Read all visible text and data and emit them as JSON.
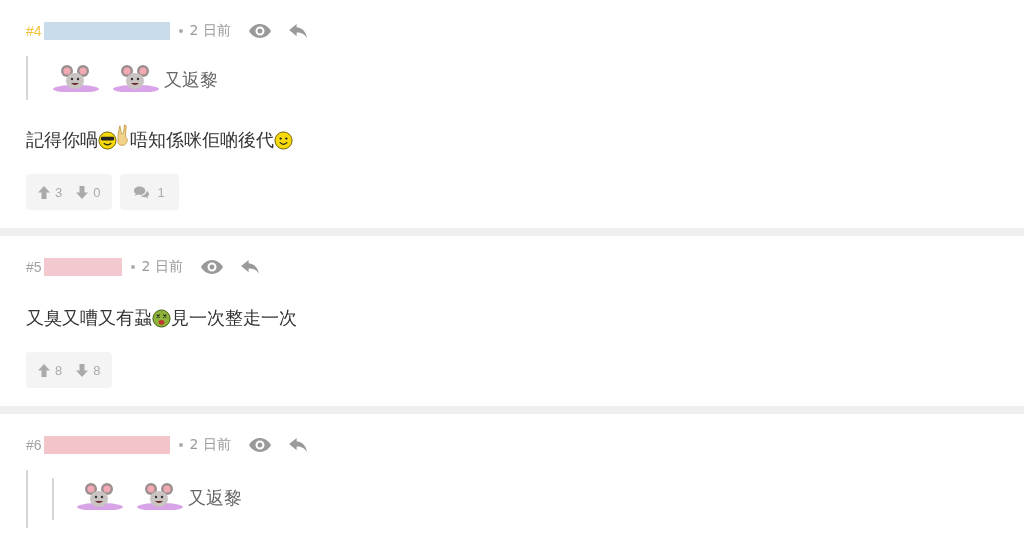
{
  "posts": [
    {
      "number": "#4",
      "highlighted": true,
      "color": "#c9dcec",
      "time": "2 日前",
      "quote": {
        "segments": [
          {
            "kind": "mouse"
          },
          {
            "kind": "mouse"
          },
          {
            "kind": "text",
            "text": "又返黎"
          }
        ]
      },
      "body": [
        {
          "kind": "text",
          "text": "記得你喎"
        },
        {
          "kind": "cool"
        },
        {
          "kind": "rock"
        },
        {
          "kind": "text",
          "text": "唔知係咪佢啲後代"
        },
        {
          "kind": "smile"
        }
      ],
      "votes": {
        "up": "3",
        "down": "0"
      },
      "replies": "1"
    },
    {
      "number": "#5",
      "highlighted": false,
      "color": "#f3c8cf",
      "time": "2 日前",
      "body": [
        {
          "kind": "text",
          "text": "又臭又嘈又有蝨"
        },
        {
          "kind": "sick"
        },
        {
          "kind": "text",
          "text": "見一次整走一次"
        }
      ],
      "votes": {
        "up": "8",
        "down": "8"
      }
    },
    {
      "number": "#6",
      "highlighted": false,
      "color": "#f3c5cb",
      "time": "2 日前",
      "quote": {
        "quote": {
          "segments": [
            {
              "kind": "mouse"
            },
            {
              "kind": "mouse"
            },
            {
              "kind": "text",
              "text": "又返黎"
            }
          ]
        }
      }
    }
  ]
}
